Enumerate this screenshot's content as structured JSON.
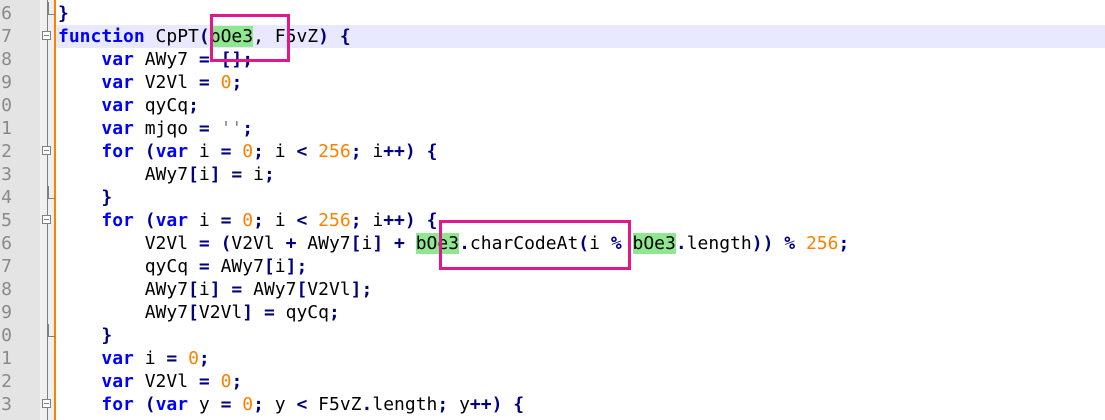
{
  "lines": [
    {
      "num": "6",
      "tokens": [
        {
          "t": "}",
          "c": "op"
        }
      ],
      "fold": "end"
    },
    {
      "num": "7",
      "tokens": [
        {
          "t": "function",
          "c": "kw"
        },
        {
          "t": " CpPT"
        },
        {
          "t": "(",
          "c": "op"
        },
        {
          "t": "bOe3",
          "c": "hl"
        },
        {
          "t": ", F5vZ"
        },
        {
          "t": ")",
          "c": "op"
        },
        {
          "t": " "
        },
        {
          "t": "{",
          "c": "op"
        }
      ],
      "fold": "start",
      "current": true
    },
    {
      "num": "8",
      "tokens": [
        {
          "t": "    "
        },
        {
          "t": "var",
          "c": "kw"
        },
        {
          "t": " AWy7 "
        },
        {
          "t": "=",
          "c": "op"
        },
        {
          "t": " "
        },
        {
          "t": "[];",
          "c": "op"
        }
      ]
    },
    {
      "num": "9",
      "tokens": [
        {
          "t": "    "
        },
        {
          "t": "var",
          "c": "kw"
        },
        {
          "t": " V2Vl "
        },
        {
          "t": "=",
          "c": "op"
        },
        {
          "t": " "
        },
        {
          "t": "0",
          "c": "num"
        },
        {
          "t": ";",
          "c": "op"
        }
      ]
    },
    {
      "num": "0",
      "tokens": [
        {
          "t": "    "
        },
        {
          "t": "var",
          "c": "kw"
        },
        {
          "t": " qyCq"
        },
        {
          "t": ";",
          "c": "op"
        }
      ]
    },
    {
      "num": "1",
      "tokens": [
        {
          "t": "    "
        },
        {
          "t": "var",
          "c": "kw"
        },
        {
          "t": " mjqo "
        },
        {
          "t": "=",
          "c": "op"
        },
        {
          "t": " "
        },
        {
          "t": "''",
          "c": "str"
        },
        {
          "t": ";",
          "c": "op"
        }
      ]
    },
    {
      "num": "2",
      "tokens": [
        {
          "t": "    "
        },
        {
          "t": "for",
          "c": "kw"
        },
        {
          "t": " "
        },
        {
          "t": "(",
          "c": "op"
        },
        {
          "t": "var",
          "c": "kw"
        },
        {
          "t": " i "
        },
        {
          "t": "=",
          "c": "op"
        },
        {
          "t": " "
        },
        {
          "t": "0",
          "c": "num"
        },
        {
          "t": ";",
          "c": "op"
        },
        {
          "t": " i "
        },
        {
          "t": "<",
          "c": "op"
        },
        {
          "t": " "
        },
        {
          "t": "256",
          "c": "num"
        },
        {
          "t": ";",
          "c": "op"
        },
        {
          "t": " i"
        },
        {
          "t": "++)",
          "c": "op"
        },
        {
          "t": " "
        },
        {
          "t": "{",
          "c": "op"
        }
      ],
      "fold": "start"
    },
    {
      "num": "3",
      "tokens": [
        {
          "t": "        AWy7"
        },
        {
          "t": "[",
          "c": "op"
        },
        {
          "t": "i"
        },
        {
          "t": "]",
          "c": "op"
        },
        {
          "t": " "
        },
        {
          "t": "=",
          "c": "op"
        },
        {
          "t": " i"
        },
        {
          "t": ";",
          "c": "op"
        }
      ]
    },
    {
      "num": "4",
      "tokens": [
        {
          "t": "    "
        },
        {
          "t": "}",
          "c": "op"
        }
      ],
      "fold": "end"
    },
    {
      "num": "5",
      "tokens": [
        {
          "t": "    "
        },
        {
          "t": "for",
          "c": "kw"
        },
        {
          "t": " "
        },
        {
          "t": "(",
          "c": "op"
        },
        {
          "t": "var",
          "c": "kw"
        },
        {
          "t": " i "
        },
        {
          "t": "=",
          "c": "op"
        },
        {
          "t": " "
        },
        {
          "t": "0",
          "c": "num"
        },
        {
          "t": ";",
          "c": "op"
        },
        {
          "t": " i "
        },
        {
          "t": "<",
          "c": "op"
        },
        {
          "t": " "
        },
        {
          "t": "256",
          "c": "num"
        },
        {
          "t": ";",
          "c": "op"
        },
        {
          "t": " i"
        },
        {
          "t": "++)",
          "c": "op"
        },
        {
          "t": " "
        },
        {
          "t": "{",
          "c": "op"
        }
      ],
      "fold": "start"
    },
    {
      "num": "6",
      "tokens": [
        {
          "t": "        V2Vl "
        },
        {
          "t": "=",
          "c": "op"
        },
        {
          "t": " "
        },
        {
          "t": "(",
          "c": "op"
        },
        {
          "t": "V2Vl "
        },
        {
          "t": "+",
          "c": "op"
        },
        {
          "t": " AWy7"
        },
        {
          "t": "[",
          "c": "op"
        },
        {
          "t": "i"
        },
        {
          "t": "]",
          "c": "op"
        },
        {
          "t": " "
        },
        {
          "t": "+",
          "c": "op"
        },
        {
          "t": " "
        },
        {
          "t": "bOe3",
          "c": "hl"
        },
        {
          "t": ".",
          "c": "op"
        },
        {
          "t": "charCodeAt"
        },
        {
          "t": "(",
          "c": "op"
        },
        {
          "t": "i "
        },
        {
          "t": "%",
          "c": "op"
        },
        {
          "t": " "
        },
        {
          "t": "bOe3",
          "c": "hl"
        },
        {
          "t": ".",
          "c": "op"
        },
        {
          "t": "length"
        },
        {
          "t": "))",
          "c": "op"
        },
        {
          "t": " "
        },
        {
          "t": "%",
          "c": "op"
        },
        {
          "t": " "
        },
        {
          "t": "256",
          "c": "num"
        },
        {
          "t": ";",
          "c": "op"
        }
      ]
    },
    {
      "num": "7",
      "tokens": [
        {
          "t": "        qyCq "
        },
        {
          "t": "=",
          "c": "op"
        },
        {
          "t": " AWy7"
        },
        {
          "t": "[",
          "c": "op"
        },
        {
          "t": "i"
        },
        {
          "t": "];",
          "c": "op"
        }
      ]
    },
    {
      "num": "8",
      "tokens": [
        {
          "t": "        AWy7"
        },
        {
          "t": "[",
          "c": "op"
        },
        {
          "t": "i"
        },
        {
          "t": "]",
          "c": "op"
        },
        {
          "t": " "
        },
        {
          "t": "=",
          "c": "op"
        },
        {
          "t": " AWy7"
        },
        {
          "t": "[",
          "c": "op"
        },
        {
          "t": "V2Vl"
        },
        {
          "t": "];",
          "c": "op"
        }
      ]
    },
    {
      "num": "9",
      "tokens": [
        {
          "t": "        AWy7"
        },
        {
          "t": "[",
          "c": "op"
        },
        {
          "t": "V2Vl"
        },
        {
          "t": "]",
          "c": "op"
        },
        {
          "t": " "
        },
        {
          "t": "=",
          "c": "op"
        },
        {
          "t": " qyCq"
        },
        {
          "t": ";",
          "c": "op"
        }
      ]
    },
    {
      "num": "0",
      "tokens": [
        {
          "t": "    "
        },
        {
          "t": "}",
          "c": "op"
        }
      ],
      "fold": "end"
    },
    {
      "num": "1",
      "tokens": [
        {
          "t": "    "
        },
        {
          "t": "var",
          "c": "kw"
        },
        {
          "t": " i "
        },
        {
          "t": "=",
          "c": "op"
        },
        {
          "t": " "
        },
        {
          "t": "0",
          "c": "num"
        },
        {
          "t": ";",
          "c": "op"
        }
      ]
    },
    {
      "num": "2",
      "tokens": [
        {
          "t": "    "
        },
        {
          "t": "var",
          "c": "kw"
        },
        {
          "t": " V2Vl "
        },
        {
          "t": "=",
          "c": "op"
        },
        {
          "t": " "
        },
        {
          "t": "0",
          "c": "num"
        },
        {
          "t": ";",
          "c": "op"
        }
      ]
    },
    {
      "num": "3",
      "tokens": [
        {
          "t": "    "
        },
        {
          "t": "for",
          "c": "kw"
        },
        {
          "t": " "
        },
        {
          "t": "(",
          "c": "op"
        },
        {
          "t": "var",
          "c": "kw"
        },
        {
          "t": " y "
        },
        {
          "t": "=",
          "c": "op"
        },
        {
          "t": " "
        },
        {
          "t": "0",
          "c": "num"
        },
        {
          "t": ";",
          "c": "op"
        },
        {
          "t": " y "
        },
        {
          "t": "<",
          "c": "op"
        },
        {
          "t": " F5vZ"
        },
        {
          "t": ".",
          "c": "op"
        },
        {
          "t": "length"
        },
        {
          "t": ";",
          "c": "op"
        },
        {
          "t": " y"
        },
        {
          "t": "++)",
          "c": "op"
        },
        {
          "t": " "
        },
        {
          "t": "{",
          "c": "op"
        }
      ],
      "fold": "start"
    }
  ],
  "annotations": [
    {
      "name": "highlight-box-param"
    },
    {
      "name": "highlight-box-charcodeat"
    }
  ],
  "colors": {
    "box": "#e0188c",
    "highlight": "#8fe88f",
    "keyword": "#0000ff",
    "number": "#ff8000"
  }
}
